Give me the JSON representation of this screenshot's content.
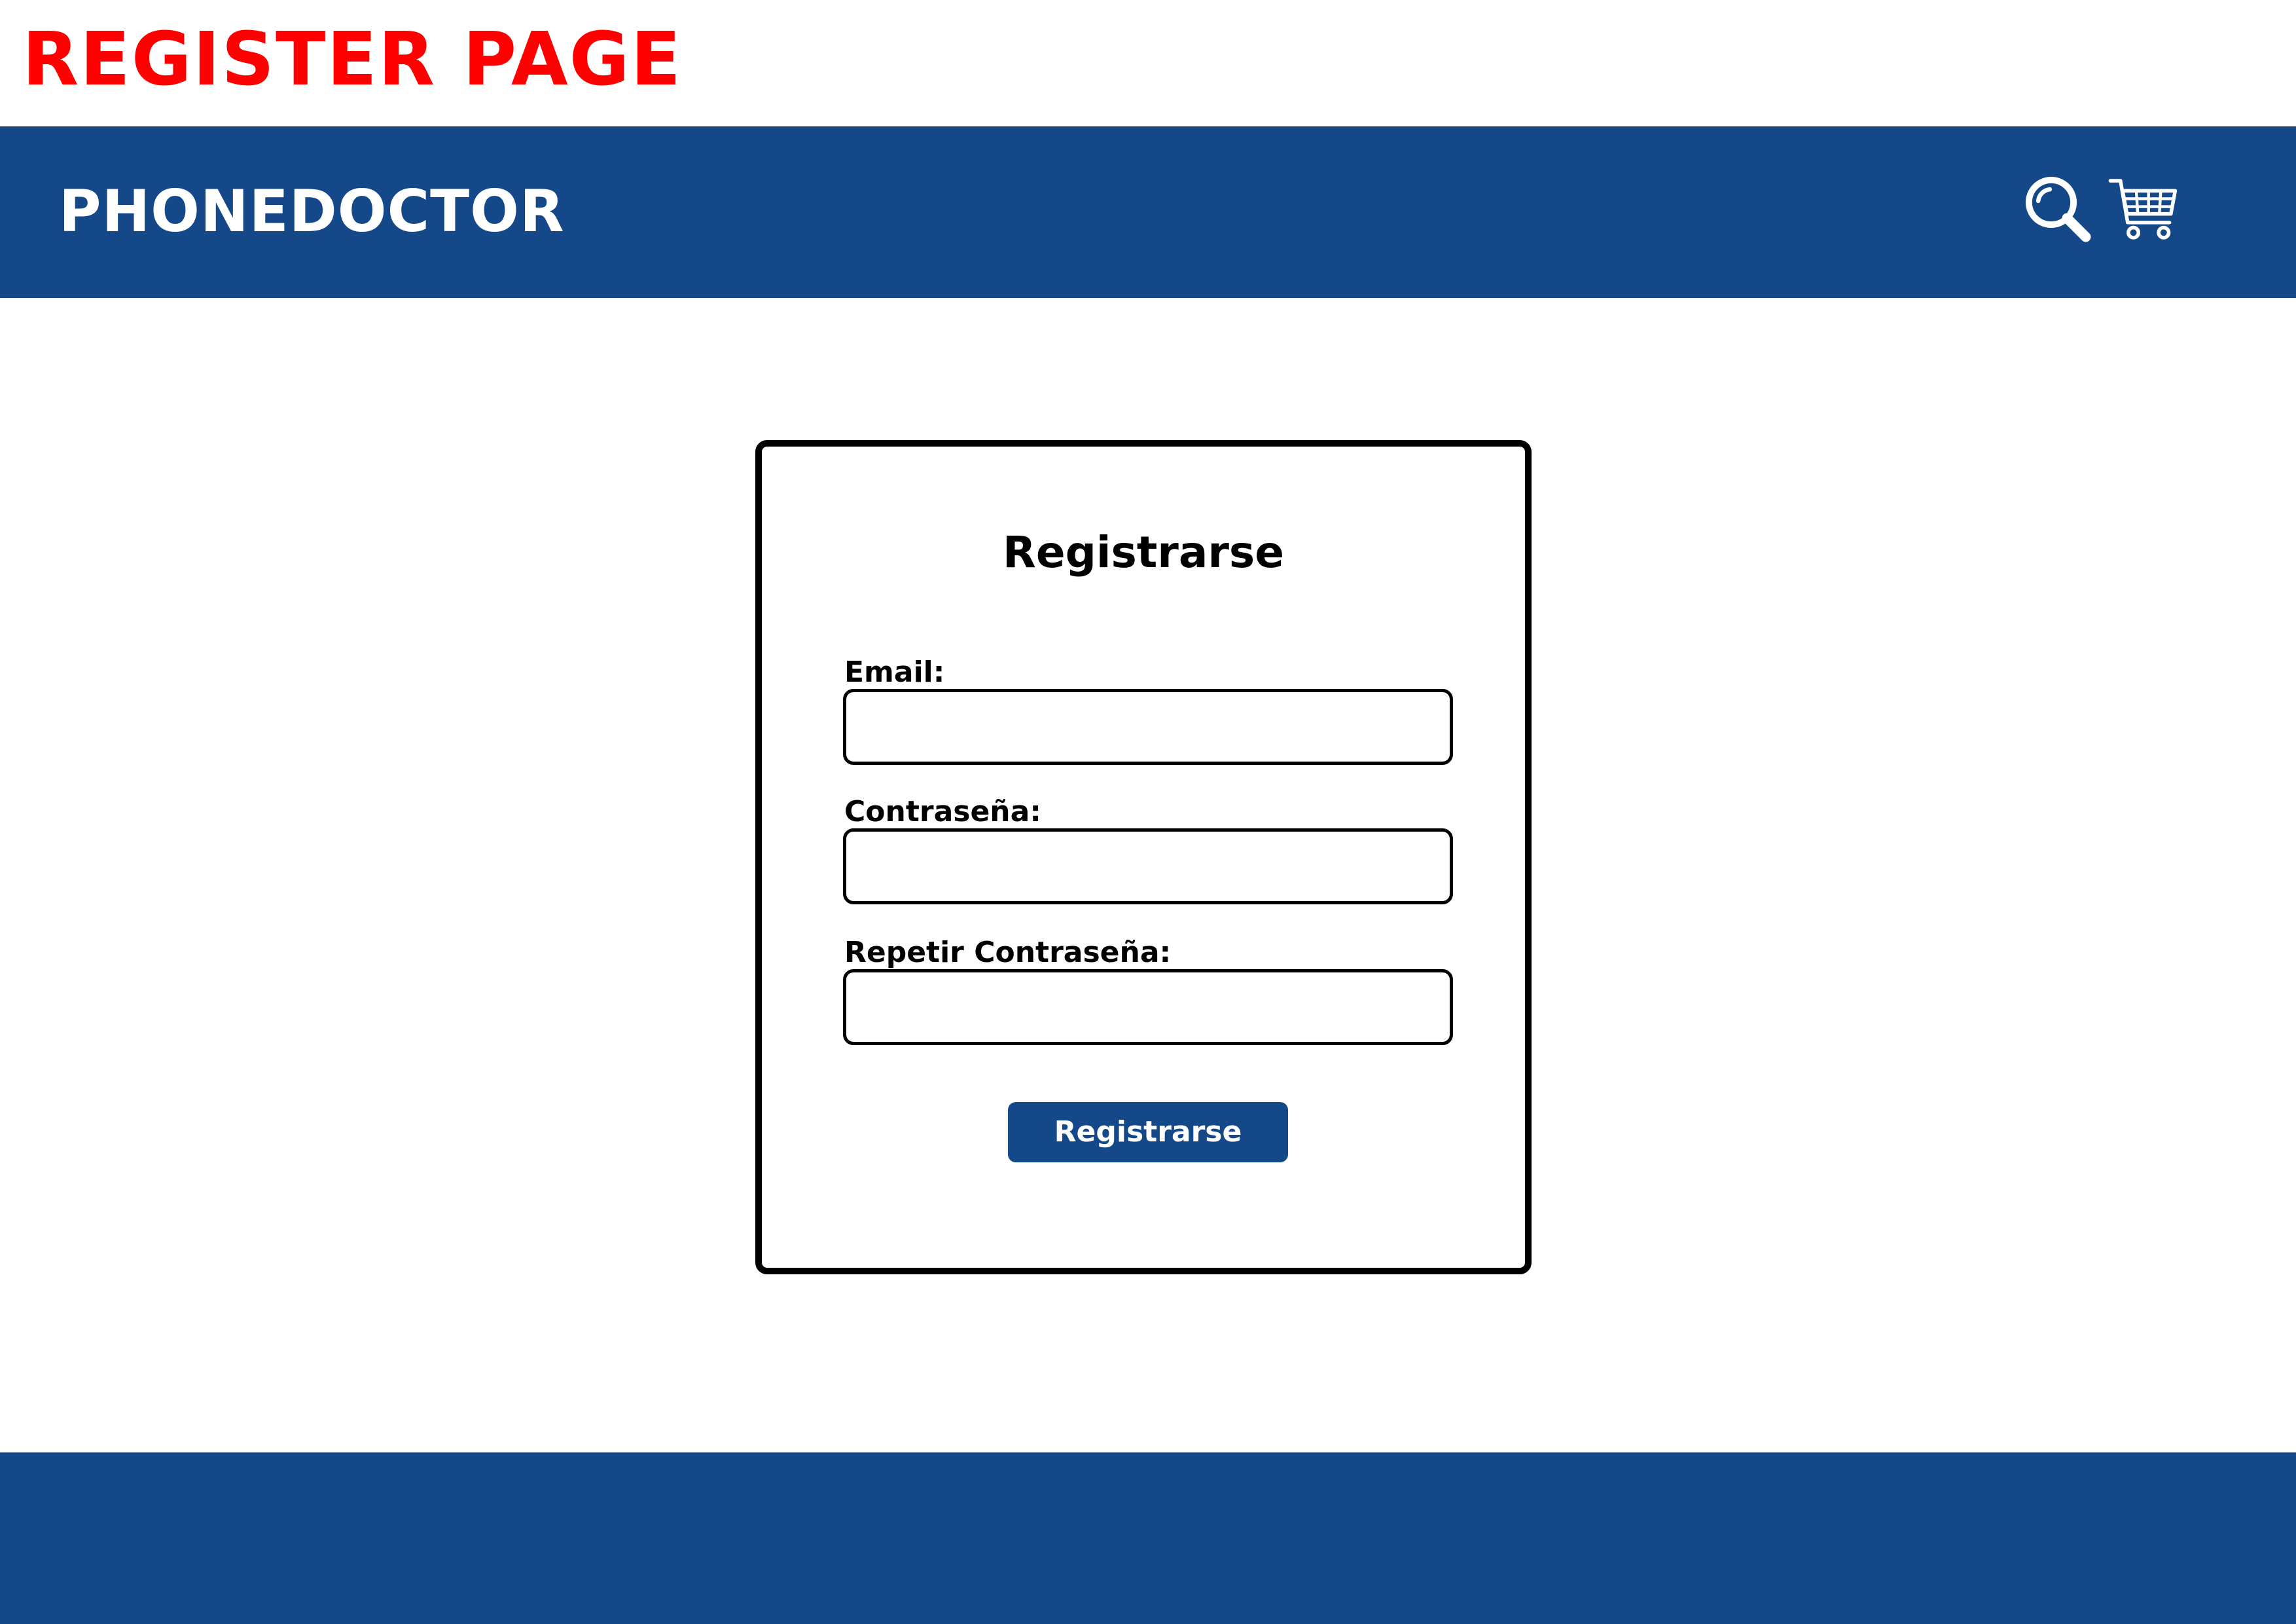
{
  "page": {
    "label": "REGISTER PAGE"
  },
  "header": {
    "brand": "PHONEDOCTOR",
    "icons": {
      "search": "search-icon",
      "cart": "cart-icon"
    }
  },
  "form": {
    "title": "Registrarse",
    "fields": [
      {
        "label": "Email:",
        "value": "",
        "placeholder": ""
      },
      {
        "label": "Contraseña:",
        "value": "",
        "placeholder": ""
      },
      {
        "label": "Repetir Contraseña:",
        "value": "",
        "placeholder": ""
      }
    ],
    "submit_label": "Registrarse"
  },
  "colors": {
    "brand_blue": "#154889",
    "page_label_red": "#ff0000",
    "card_border": "#000000",
    "background": "#ffffff"
  }
}
